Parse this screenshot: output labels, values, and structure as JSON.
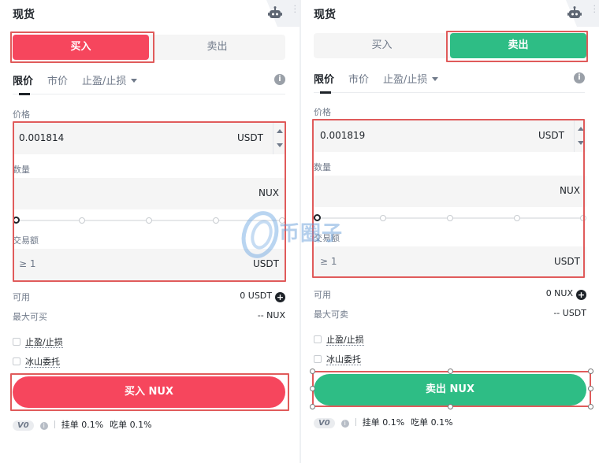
{
  "left": {
    "title": "现货",
    "tabs": {
      "buy": "买入",
      "sell": "卖出"
    },
    "order_types": {
      "limit": "限价",
      "market": "市价",
      "stop": "止盈/止损"
    },
    "price": {
      "label": "价格",
      "value": "0.001814",
      "unit": "USDT"
    },
    "amount": {
      "label": "数量",
      "unit": "NUX"
    },
    "total": {
      "label": "交易额",
      "placeholder": "≥ 1",
      "unit": "USDT"
    },
    "available": {
      "label": "可用",
      "value": "0 USDT"
    },
    "max": {
      "label": "最大可买",
      "value": "-- NUX"
    },
    "options": {
      "tpsl": "止盈/止损",
      "iceberg": "冰山委托"
    },
    "submit": "买入 NUX",
    "fees": {
      "level": "V0",
      "maker": "挂单 0.1%",
      "taker": "吃单 0.1%"
    }
  },
  "right": {
    "title": "现货",
    "tabs": {
      "buy": "买入",
      "sell": "卖出"
    },
    "order_types": {
      "limit": "限价",
      "market": "市价",
      "stop": "止盈/止损"
    },
    "price": {
      "label": "价格",
      "value": "0.001819",
      "unit": "USDT"
    },
    "amount": {
      "label": "数量",
      "unit": "NUX"
    },
    "total": {
      "label": "交易额",
      "placeholder": "≥ 1",
      "unit": "USDT"
    },
    "available": {
      "label": "可用",
      "value": "0 NUX"
    },
    "max": {
      "label": "最大可卖",
      "value": "-- USDT"
    },
    "options": {
      "tpsl": "止盈/止损",
      "iceberg": "冰山委托"
    },
    "submit": "卖出 NUX",
    "fees": {
      "level": "V0",
      "maker": "挂单 0.1%",
      "taker": "吃单 0.1%"
    }
  },
  "watermark": {
    "text": "币圈子"
  },
  "colors": {
    "buy": "#f6465d",
    "sell": "#2ebd85",
    "highlight": "#e05b5b"
  }
}
